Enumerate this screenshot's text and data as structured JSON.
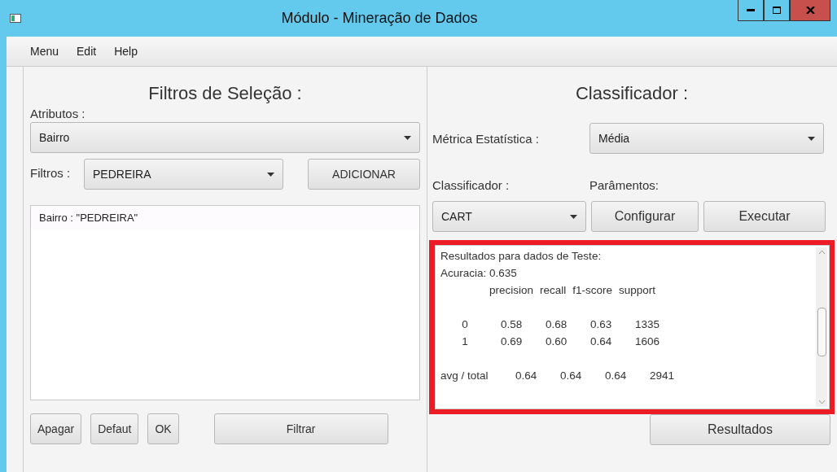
{
  "window": {
    "title": "Módulo - Mineração de Dados"
  },
  "menu": [
    "Menu",
    "Edit",
    "Help"
  ],
  "filters_panel": {
    "title": "Filtros de Seleção :",
    "attributes_label": "Atributos :",
    "attribute_value": "Bairro",
    "filters_label": "Filtros :",
    "filter_value": "PEDREIRA",
    "add_button": "ADICIONAR",
    "list_items": [
      "Bairro : \"PEDREIRA\""
    ],
    "buttons": [
      "Apagar",
      "Defaut",
      "OK",
      "Filtrar"
    ]
  },
  "classifier_panel": {
    "title": "Classificador :",
    "metric_label": "Métrica Estatística :",
    "metric_value": "Média",
    "classifier_label": "Classificador :",
    "params_label": "Parâmentos:",
    "classifier_value": "CART",
    "configure_button": "Configurar",
    "run_button": "Executar",
    "results": {
      "highlighted": true,
      "heading": "Resultados para dados de Teste:",
      "accuracy": "Acuracia: 0.635",
      "columns": [
        "precision",
        "recall",
        "f1-score",
        "support"
      ],
      "rows": [
        {
          "label": "0",
          "values": [
            "0.58",
            "0.68",
            "0.63",
            "1335"
          ]
        },
        {
          "label": "1",
          "values": [
            "0.69",
            "0.60",
            "0.64",
            "1606"
          ]
        }
      ],
      "summary": {
        "label": "avg / total",
        "values": [
          "0.64",
          "0.64",
          "0.64",
          "2941"
        ]
      }
    },
    "results_button": "Resultados"
  }
}
